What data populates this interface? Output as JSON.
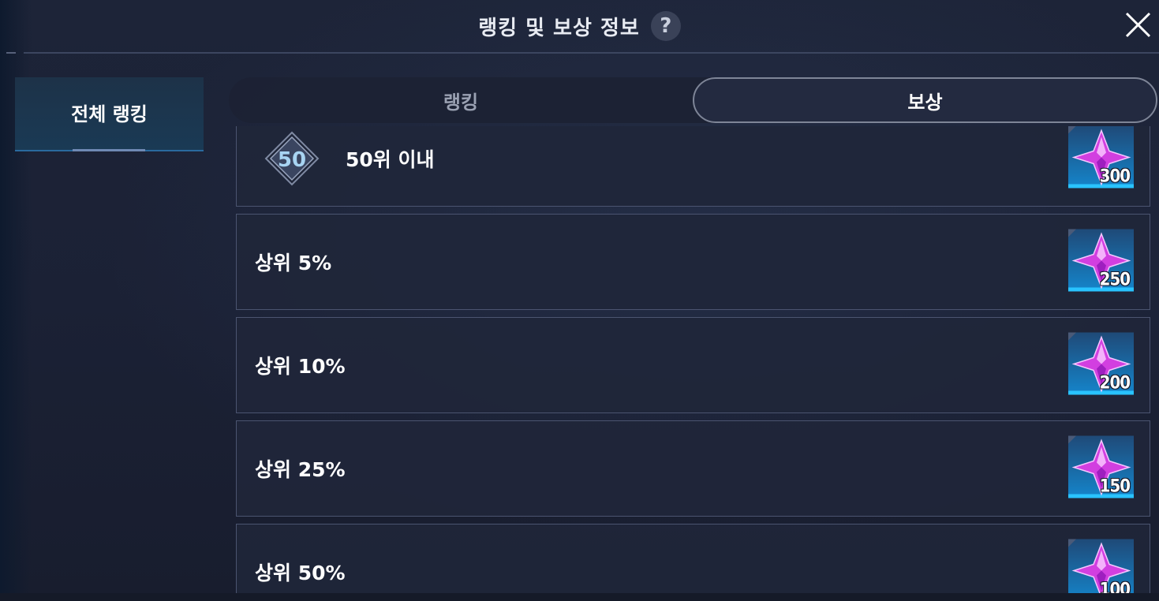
{
  "header": {
    "title": "랭킹 및 보상 정보",
    "help_icon": "?"
  },
  "sidebar": {
    "tab_label": "전체 랭킹"
  },
  "tabs": {
    "ranking_label": "랭킹",
    "reward_label": "보상",
    "selected": "보상"
  },
  "rewards": [
    {
      "badge": "50",
      "label": "50위 이내",
      "item_icon": "purple-crystal-icon",
      "quantity": "300"
    },
    {
      "label": "상위 5%",
      "item_icon": "purple-crystal-icon",
      "quantity": "250"
    },
    {
      "label": "상위 10%",
      "item_icon": "purple-crystal-icon",
      "quantity": "200"
    },
    {
      "label": "상위 25%",
      "item_icon": "purple-crystal-icon",
      "quantity": "150"
    },
    {
      "label": "상위 50%",
      "item_icon": "purple-crystal-icon",
      "quantity": "100"
    }
  ],
  "colors": {
    "accent_blue": "#1aa6e6",
    "crystal": "#e04ce8",
    "panel_border": "#4b5470"
  }
}
